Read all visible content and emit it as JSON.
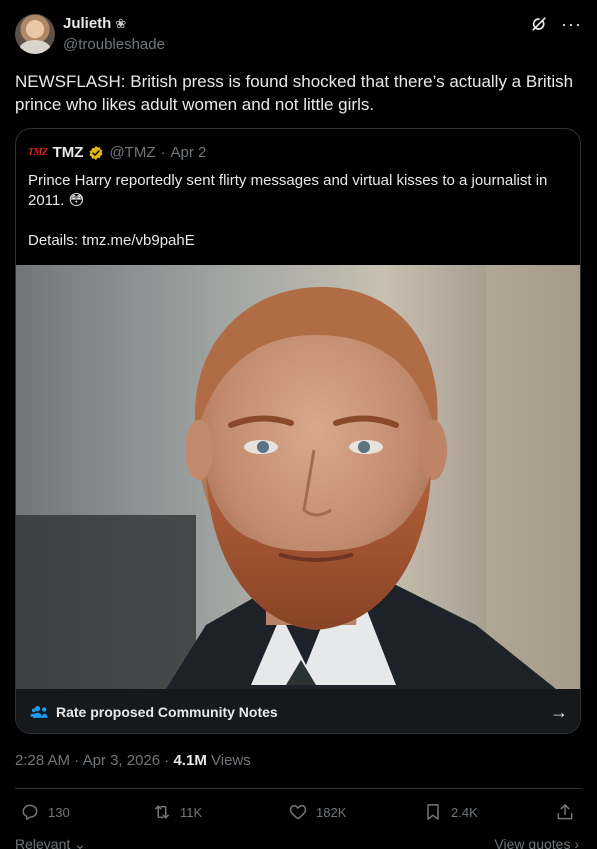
{
  "author": {
    "name": "Julieth",
    "badge_icon": "flower-icon",
    "handle": "@troubleshade"
  },
  "tweet": {
    "text": "NEWSFLASH: British press is found shocked that there’s actually a British prince who likes adult women and not little girls."
  },
  "quote": {
    "logo_text": "TMZ",
    "name": "TMZ",
    "handle": "@TMZ",
    "separator": "·",
    "date": "Apr 2",
    "text": "Prince Harry reportedly sent flirty messages and virtual kisses to a journalist in 2011. 😳\n\nDetails: tmz.me/vb9pahE",
    "community_notes_label": "Rate proposed Community Notes"
  },
  "meta": {
    "time": "2:28 AM",
    "separator": "·",
    "date": "Apr 3, 2026",
    "views_count": "4.1M",
    "views_label": "Views"
  },
  "actions": {
    "replies": "130",
    "reposts": "11K",
    "likes": "182K",
    "bookmarks": "2.4K"
  },
  "footer": {
    "left": "Relevant",
    "right": "View quotes"
  },
  "colors": {
    "background": "#000000",
    "text": "#e7e9ea",
    "muted": "#71767b",
    "border": "#2f3336",
    "verified_gold": "#e2b719",
    "notes_blue": "#1d9bf0",
    "tmz_red": "#e0221b"
  }
}
